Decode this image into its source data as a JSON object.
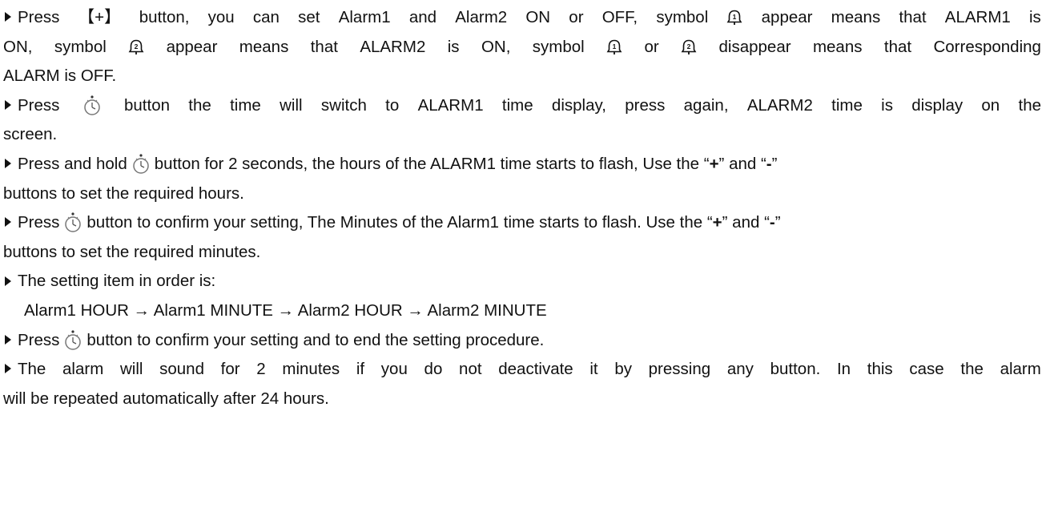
{
  "para1": {
    "l1": [
      "Press",
      "【+】",
      "button,",
      "you",
      "can",
      "set",
      "Alarm1",
      "and",
      "Alarm2",
      "ON",
      "or",
      "OFF,",
      "symbol",
      "",
      "appear",
      "means",
      "that",
      "ALARM1",
      "is"
    ],
    "l2": [
      "ON,",
      "symbol",
      "",
      "appear",
      "means",
      "that",
      "ALARM2",
      "is",
      "ON,",
      "symbol",
      "",
      "or",
      "",
      "disappear",
      "means",
      "that",
      "Corresponding"
    ],
    "l3": "ALARM is OFF."
  },
  "para2": {
    "l1_pre": "Press",
    "l1_post": [
      "button",
      "the",
      "time",
      "will",
      "switch",
      "to",
      "ALARM1",
      "time",
      "display,",
      "press",
      "again,",
      "ALARM2",
      "time",
      "is",
      "display",
      "on",
      "the"
    ],
    "l2": "screen."
  },
  "para3": {
    "l1_pre": "Press and hold",
    "l1_post": "button for 2 seconds, the hours of the ALARM1 time starts to flash, Use the “",
    "plus": "+",
    "mid": "” and “",
    "minus": "-",
    "end": "”",
    "l2": "buttons to set the required hours."
  },
  "para4": {
    "l1_pre": "Press",
    "l1_post": "button to confirm your setting, The Minutes of the Alarm1 time starts to flash. Use the “",
    "plus": "+",
    "mid": "” and “",
    "minus": "-",
    "end": "”",
    "l2": "buttons to set the required minutes."
  },
  "para5": {
    "l1": "The setting item in order is:",
    "flow": "Alarm1 HOUR → Alarm1 MINUTE → Alarm2 HOUR → Alarm2 MINUTE"
  },
  "para6": {
    "pre": "Press",
    "post": "button to confirm your setting and to end the setting procedure."
  },
  "para7": {
    "l1": [
      "The",
      "alarm",
      "will",
      "sound",
      "for",
      "2",
      "minutes",
      "if",
      "you",
      "do",
      "not",
      "deactivate",
      "it",
      "by",
      "pressing",
      "any",
      "button.",
      "In",
      "this",
      "case",
      "the",
      "alarm"
    ],
    "l2": "will be repeated automatically after 24 hours."
  },
  "icons": {
    "bullet": "triangle-bullet-icon",
    "alarm1": "alarm1-bell-icon",
    "alarm2": "alarm2-bell-icon",
    "alarm_button": "alarm-clock-button-icon"
  }
}
